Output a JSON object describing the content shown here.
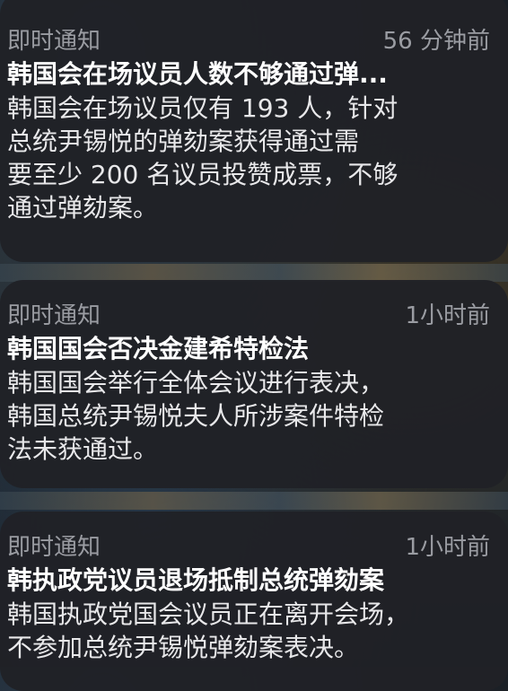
{
  "notifications": [
    {
      "app": "即时通知",
      "time": "56 分钟前",
      "title": "韩国会在场议员人数不够通过弹...",
      "body": "韩国会在场议员仅有 193 人，针对\n总统尹锡悦的弹劾案获得通过需\n要至少 200 名议员投赞成票，不够\n通过弹劾案。"
    },
    {
      "app": "即时通知",
      "time": "1小时前",
      "title": "韩国国会否决金建希特检法",
      "body": "韩国国会举行全体会议进行表决，\n韩国总统尹锡悦夫人所涉案件特检\n法未获通过。"
    },
    {
      "app": "即时通知",
      "time": "1小时前",
      "title": "韩执政党议员退场抵制总统弹劾案",
      "body": "韩国执政党国会议员正在离开会场，\n不参加总统尹锡悦弹劾案表决。"
    }
  ]
}
